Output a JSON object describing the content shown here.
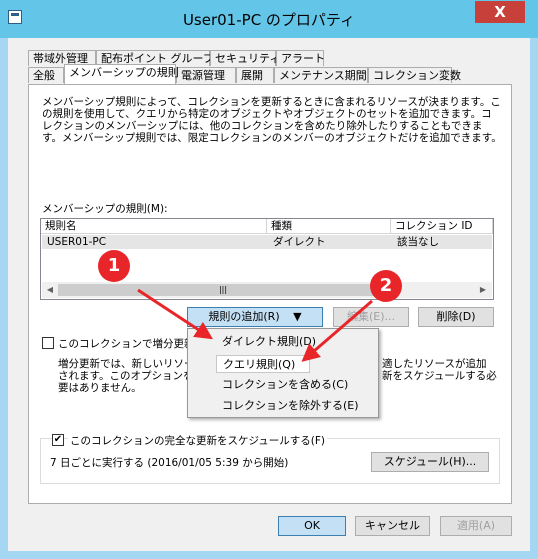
{
  "window": {
    "title": "User01-PC のプロパティ",
    "close_glyph": "X"
  },
  "tabs_row1": [
    "帯域外管理",
    "配布ポイント グループ",
    "セキュリティ",
    "アラート"
  ],
  "tabs_row2": [
    "全般",
    "メンバーシップの規則",
    "電源管理",
    "展開",
    "メンテナンス期間",
    "コレクション変数"
  ],
  "description": "メンバーシップ規則によって、コレクションを更新するときに含まれるリソースが決まります。この規則を使用して、クエリから特定のオブジェクトやオブジェクトのセットを追加できます。コレクションのメンバーシップには、他のコレクションを含めたり除外したりすることもできます。メンバーシップ規則では、限定コレクションのメンバーのオブジェクトだけを追加できます。",
  "rules_label": "メンバーシップの規則(M):",
  "table": {
    "columns": [
      "規則名",
      "種類",
      "コレクション ID"
    ],
    "rows": [
      [
        "USER01-PC",
        "ダイレクト",
        "該当なし"
      ]
    ]
  },
  "buttons": {
    "add_rule": "規則の追加(R)",
    "edit": "編集(E)...",
    "delete": "削除(D)",
    "schedule": "スケジュール(H)...",
    "ok": "OK",
    "cancel": "キャンセル",
    "apply": "適用(A)"
  },
  "incremental": {
    "label": "このコレクションで増分更新を",
    "desc_left": "増分更新では、新しいリソー\nされます。このオプションを選択\n要はありません。",
    "desc_right": "適したリソースが追加\n新をスケジュールする必"
  },
  "full_update": {
    "label": "このコレクションの完全な更新をスケジュールする(F)",
    "schedule_text": "7 日ごとに実行する (2016/01/05 5:39 から開始)"
  },
  "add_menu": [
    "ダイレクト規則(D)",
    "クエリ規則(Q)",
    "コレクションを含める(C)",
    "コレクションを除外する(E)"
  ],
  "badges": [
    "1",
    "2"
  ],
  "colors": {
    "title_bar": "#63c6e9",
    "badge": "#e8262a"
  }
}
